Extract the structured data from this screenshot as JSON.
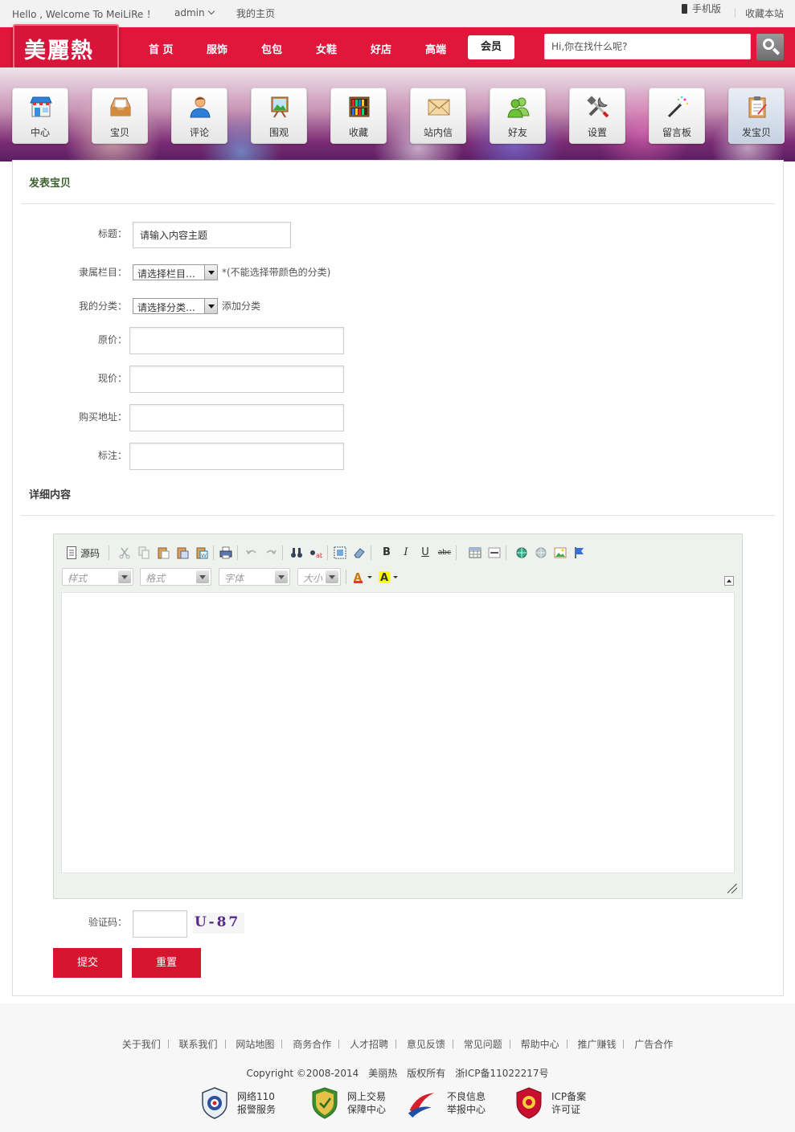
{
  "topbar": {
    "greeting": "Hello , Welcome To MeiLiRe ！",
    "username": "admin",
    "home_link": "我的主页",
    "mobile_link": "手机版",
    "bookmark_link": "收藏本站"
  },
  "brand": {
    "logo_text": "美麗熱",
    "primary_color": "#e0173b"
  },
  "nav": {
    "items": [
      {
        "label": "首 页"
      },
      {
        "label": "服饰"
      },
      {
        "label": "包包"
      },
      {
        "label": "女鞋"
      },
      {
        "label": "好店"
      },
      {
        "label": "高端"
      },
      {
        "label": "会员",
        "active": true
      }
    ]
  },
  "search": {
    "placeholder": "Hi,你在找什么呢?"
  },
  "member_menu": [
    {
      "label": "中心",
      "icon": "store-icon"
    },
    {
      "label": "宝贝",
      "icon": "inbox-icon"
    },
    {
      "label": "评论",
      "icon": "user-icon"
    },
    {
      "label": "围观",
      "icon": "easel-icon"
    },
    {
      "label": "收藏",
      "icon": "bookshelf-icon"
    },
    {
      "label": "站内信",
      "icon": "envelope-icon"
    },
    {
      "label": "好友",
      "icon": "friends-icon"
    },
    {
      "label": "设置",
      "icon": "tools-icon"
    },
    {
      "label": "留言板",
      "icon": "magic-wand-icon"
    },
    {
      "label": "发宝贝",
      "icon": "clipboard-icon",
      "active": true
    }
  ],
  "form": {
    "title": "发表宝贝",
    "fields": {
      "subject": {
        "label": "标题：",
        "value": "请输入内容主题"
      },
      "column": {
        "label": "隶属栏目：",
        "selected": "请选择栏目…",
        "hint": "*(不能选择带颜色的分类)"
      },
      "category": {
        "label": "我的分类：",
        "selected": "请选择分类…",
        "add_link": "添加分类"
      },
      "original_price": {
        "label": "原价：",
        "value": ""
      },
      "current_price": {
        "label": "现价：",
        "value": ""
      },
      "buy_url": {
        "label": "购买地址：",
        "value": ""
      },
      "remark": {
        "label": "标注：",
        "value": ""
      }
    },
    "detail_title": "详细内容",
    "editor": {
      "source_label": "源码",
      "style_placeholder": "样式",
      "format_placeholder": "格式",
      "font_placeholder": "字体",
      "size_placeholder": "大小",
      "content": ""
    },
    "captcha": {
      "label": "验证码：",
      "value": "",
      "image_text": "U-87"
    },
    "submit_label": "提交",
    "reset_label": "重置"
  },
  "footer": {
    "links": [
      "关于我们",
      "联系我们",
      "网站地图",
      "商务合作",
      "人才招聘",
      "意见反馈",
      "常见问题",
      "帮助中心",
      "推广赚钱",
      "广告合作"
    ],
    "copyright": "Copyright ©2008-2014　美丽热　版权所有　浙ICP备11022217号",
    "badges": [
      {
        "line1": "网络110",
        "line2": "报警服务",
        "icon": "police-badge-icon"
      },
      {
        "line1": "网上交易",
        "line2": "保障中心",
        "icon": "shield-icon"
      },
      {
        "line1": "不良信息",
        "line2": "举报中心",
        "icon": "report-icon"
      },
      {
        "line1": "ICP备案",
        "line2": "许可证",
        "icon": "icp-seal-icon"
      }
    ]
  }
}
